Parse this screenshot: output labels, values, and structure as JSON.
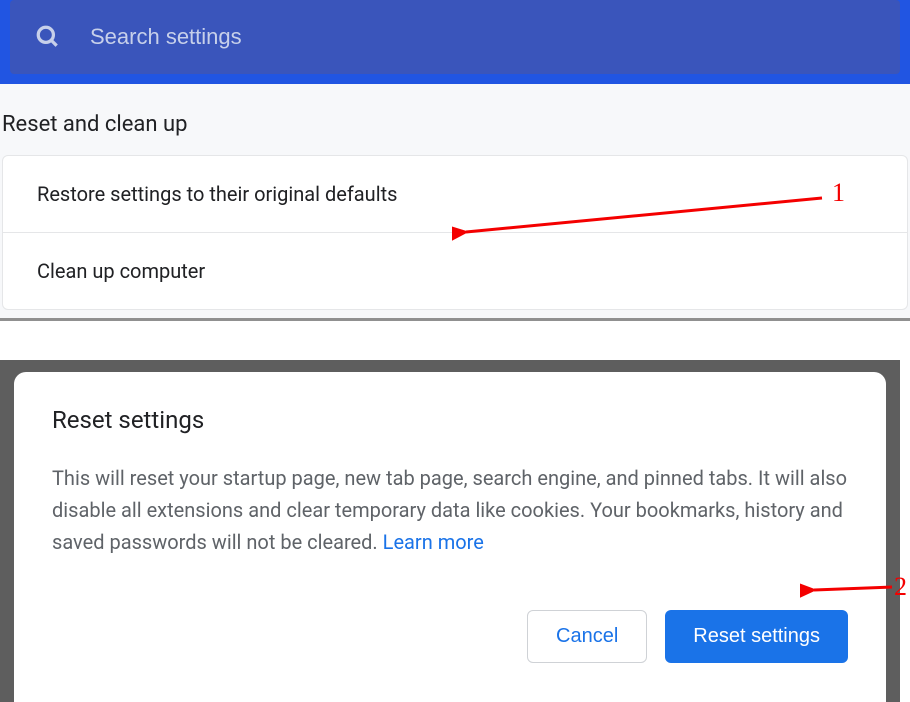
{
  "search": {
    "placeholder": "Search settings"
  },
  "section": {
    "title": "Reset and clean up",
    "rows": {
      "restore": "Restore settings to their original defaults",
      "cleanup": "Clean up computer"
    }
  },
  "dialog": {
    "title": "Reset settings",
    "body": "This will reset your startup page, new tab page, search engine, and pinned tabs. It will also disable all extensions and clear temporary data like cookies. Your bookmarks, history and saved passwords will not be cleared. ",
    "learn_more": "Learn more",
    "cancel": "Cancel",
    "confirm": "Reset settings"
  },
  "annotations": {
    "one": "1",
    "two": "2"
  }
}
